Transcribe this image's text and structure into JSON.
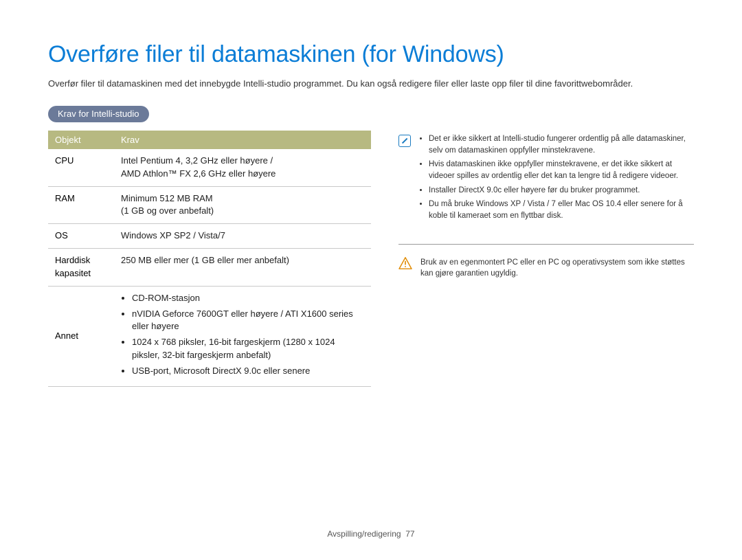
{
  "title": "Overføre filer til datamaskinen (for Windows)",
  "intro": "Overfør filer til datamaskinen med det innebygde Intelli-studio programmet. Du kan også redigere filer eller laste opp filer til dine favorittwebområder.",
  "pill": "Krav for Intelli-studio",
  "table": {
    "headers": {
      "objekt": "Objekt",
      "krav": "Krav"
    },
    "rows": {
      "cpu": {
        "label": "CPU",
        "value_line1": "Intel Pentium 4, 3,2 GHz eller høyere /",
        "value_line2": "AMD Athlon™ FX 2,6 GHz eller høyere"
      },
      "ram": {
        "label": "RAM",
        "value_line1": "Minimum 512 MB RAM",
        "value_line2": "(1 GB og over anbefalt)"
      },
      "os": {
        "label": "OS",
        "value": "Windows XP SP2 / Vista/7"
      },
      "hdd": {
        "label_line1": "Harddisk",
        "label_line2": "kapasitet",
        "value": "250 MB eller mer (1 GB eller mer anbefalt)"
      },
      "annet": {
        "label": "Annet",
        "items": {
          "a": "CD-ROM-stasjon",
          "b": "nVIDIA Geforce 7600GT eller høyere / ATI X1600 series eller høyere",
          "c": "1024 x 768 piksler, 16-bit fargeskjerm (1280 x 1024 piksler, 32-bit fargeskjerm anbefalt)",
          "d": "USB-port, Microsoft DirectX 9.0c eller senere"
        }
      }
    }
  },
  "notes": {
    "a": "Det er ikke sikkert at Intelli-studio fungerer ordentlig på alle datamaskiner, selv om datamaskinen oppfyller minstekravene.",
    "b": "Hvis datamaskinen ikke oppfyller minstekravene, er det ikke sikkert at videoer spilles av ordentlig eller det kan ta lengre tid å redigere videoer.",
    "c": "Installer DirectX 9.0c eller høyere før du bruker programmet.",
    "d": "Du må bruke Windows XP / Vista / 7 eller Mac OS 10.4 eller senere for å koble til kameraet som en flyttbar disk."
  },
  "warning": "Bruk av en egenmontert PC eller en PC og operativsystem som ikke støttes kan gjøre garantien ugyldig.",
  "footer": {
    "section": "Avspilling/redigering",
    "page": "77"
  }
}
